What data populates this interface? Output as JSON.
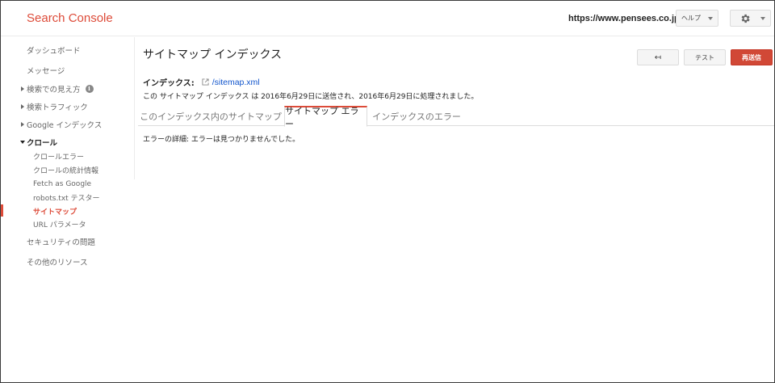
{
  "header": {
    "logo": "Search Console",
    "site_url": "https://www.pensees.co.jp/",
    "help_label": "ヘルプ",
    "settings_icon": "gear-icon"
  },
  "sidebar": {
    "dashboard": "ダッシュボード",
    "messages": "メッセージ",
    "search_appearance": "検索での見え方",
    "search_traffic": "検索トラフィック",
    "google_index": "Google インデックス",
    "crawl": "クロール",
    "crawl_sub": {
      "crawl_errors": "クロールエラー",
      "crawl_stats": "クロールの統計情報",
      "fetch_as_google": "Fetch as Google",
      "robots_tester": "robots.txt テスター",
      "sitemaps": "サイトマップ",
      "url_params": "URL パラメータ"
    },
    "security": "セキュリティの問題",
    "other_resources": "その他のリソース"
  },
  "main": {
    "title": "サイトマップ インデックス",
    "back_symbol": "↤",
    "test_label": "テスト",
    "resubmit_label": "再送信",
    "index_label": "インデックス:",
    "index_link": "/sitemap.xml",
    "status_text": "この サイトマップ インデックス は 2016年6月29日に送信され、2016年6月29日に処理されました。",
    "tabs": [
      {
        "label": "このインデックス内のサイトマップ"
      },
      {
        "label": "サイトマップ エラー"
      },
      {
        "label": "インデックスのエラー"
      }
    ],
    "error_detail": "エラーの詳細: エラーは見つかりませんでした。"
  },
  "colors": {
    "accent": "#dd4b39",
    "link": "#1155cc"
  }
}
